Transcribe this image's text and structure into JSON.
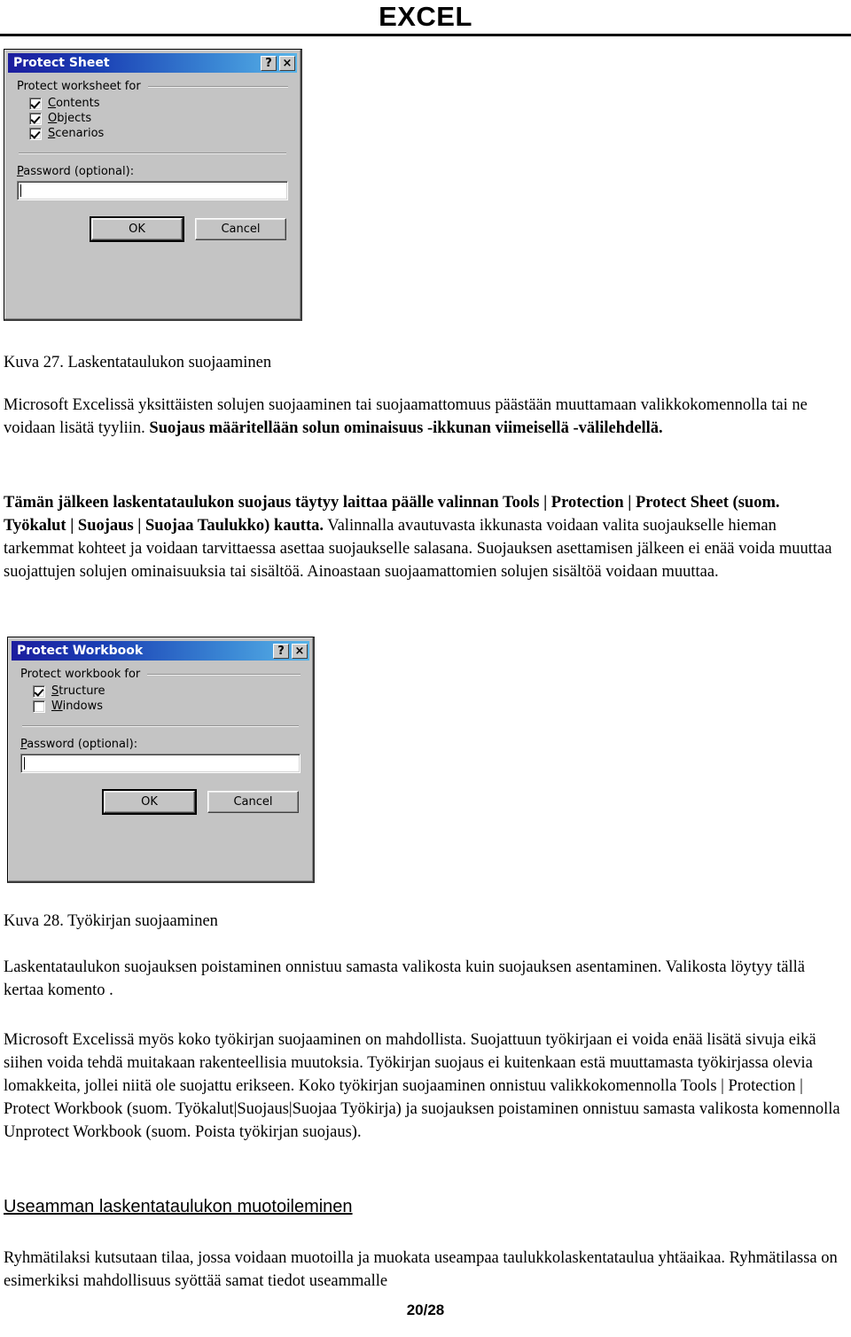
{
  "header": {
    "title": "EXCEL"
  },
  "dialog_protect_sheet": {
    "title": "Protect Sheet",
    "help_button": "?",
    "close_button": "×",
    "group_label": "Protect worksheet for",
    "checkboxes": [
      {
        "label": "Contents",
        "accel": "C",
        "rest": "ontents",
        "checked": true
      },
      {
        "label": "Objects",
        "accel": "O",
        "rest": "bjects",
        "checked": true
      },
      {
        "label": "Scenarios",
        "accel": "S",
        "rest": "cenarios",
        "checked": true
      }
    ],
    "password_label_accel": "P",
    "password_label_rest": "assword (optional):",
    "password_value": "",
    "ok_label": "OK",
    "cancel_label": "Cancel"
  },
  "dialog_protect_workbook": {
    "title": "Protect Workbook",
    "help_button": "?",
    "close_button": "×",
    "group_label": "Protect workbook for",
    "checkboxes": [
      {
        "label": "Structure",
        "accel": "S",
        "rest": "tructure",
        "checked": true
      },
      {
        "label": "Windows",
        "accel": "W",
        "rest": "indows",
        "checked": false
      }
    ],
    "password_label_accel": "P",
    "password_label_rest": "assword (optional):",
    "password_value": "",
    "ok_label": "OK",
    "cancel_label": "Cancel"
  },
  "body": {
    "caption_27": "Kuva 27. Laskentataulukon suojaaminen",
    "para_1_plain": "Microsoft Excelissä yksittäisten solujen suojaaminen tai suojaamattomuus päästään muuttamaan valikkokomennolla tai ne voidaan lisätä tyyliin. ",
    "para_1_bold": "Suojaus määritellään solun ominaisuus -ikkunan viimeisellä -välilehdellä.",
    "para_2_bold": "Tämän jälkeen laskentataulukon suojaus täytyy laittaa päälle valinnan Tools | Protection | Protect Sheet (suom. Työkalut | Suojaus | Suojaa Taulukko) kautta.",
    "para_2_plain": " Valinnalla avautuvasta ikkunasta voidaan valita suojaukselle hieman tarkemmat kohteet ja voidaan tarvittaessa asettaa suojaukselle salasana. Suojauksen asettamisen jälkeen ei enää voida muuttaa suojattujen solujen ominaisuuksia tai sisältöä. Ainoastaan suojaamattomien solujen sisältöä voidaan muuttaa.",
    "caption_28": "Kuva 28. Työkirjan suojaaminen",
    "para_3": "Laskentataulukon suojauksen poistaminen onnistuu samasta valikosta kuin suojauksen asentaminen. Valikosta löytyy tällä kertaa komento .",
    "para_4": "Microsoft Excelissä myös koko työkirjan suojaaminen on mahdollista. Suojattuun työkirjaan ei voida enää lisätä sivuja eikä siihen voida tehdä muitakaan rakenteellisia muutoksia. Työkirjan suojaus ei kuitenkaan estä muuttamasta työkirjassa olevia lomakkeita, jollei niitä ole suojattu erikseen. Koko työkirjan suojaaminen onnistuu valikkokomennolla Tools | Protection | Protect Workbook (suom. Työkalut|Suojaus|Suojaa Työkirja) ja suojauksen poistaminen onnistuu samasta valikosta komennolla Unprotect Workbook (suom. Poista työkirjan suojaus).",
    "heading_1": "Useamman laskentataulukon muotoileminen",
    "para_5": "Ryhmätilaksi kutsutaan tilaa, jossa voidaan muotoilla ja muokata useampaa taulukkolaskentataulua yhtäaikaa. Ryhmätilassa on esimerkiksi mahdollisuus syöttää samat tiedot useammalle"
  },
  "footer": {
    "page": "20/28"
  }
}
